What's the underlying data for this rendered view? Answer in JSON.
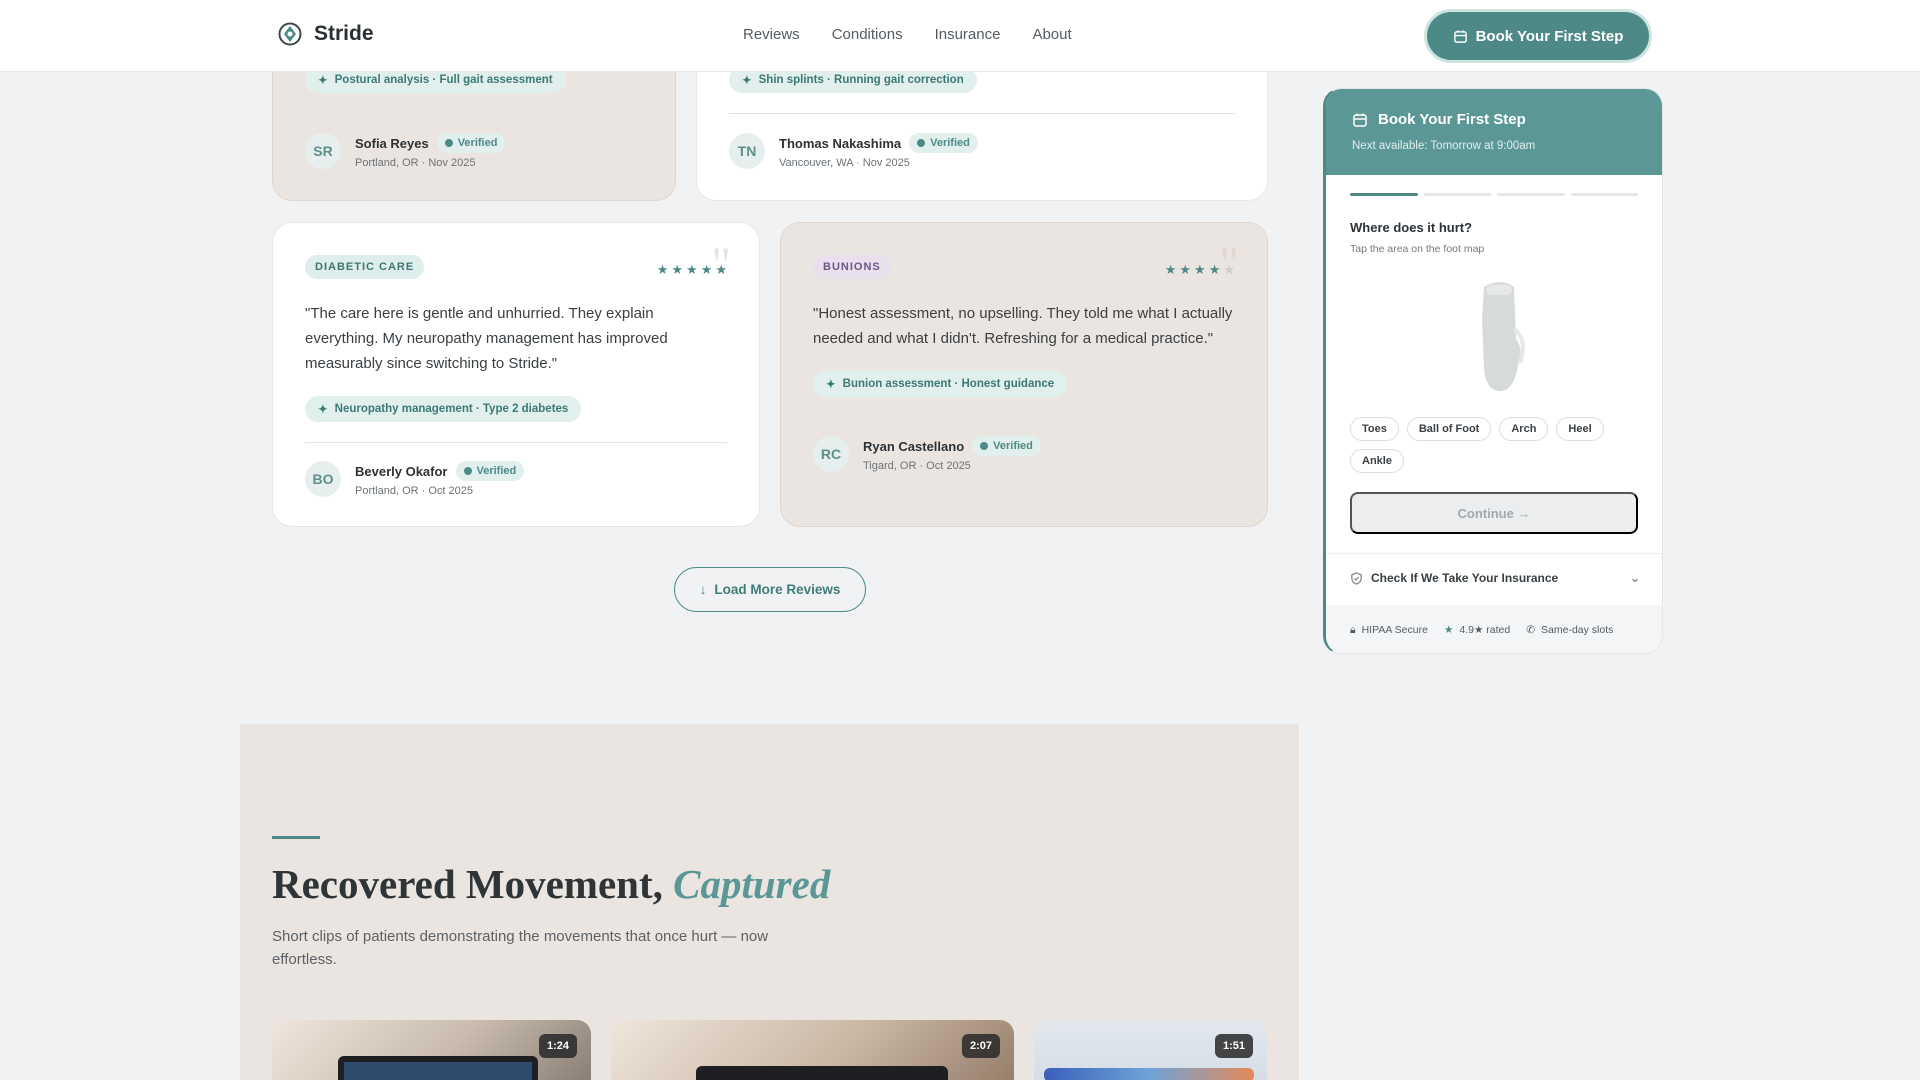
{
  "header": {
    "brand": "Stride",
    "nav": [
      "Reviews",
      "Conditions",
      "Insurance",
      "About"
    ],
    "cta": "Book Your First Step"
  },
  "reviews": [
    {
      "tag": "Postural analysis · Full gait assessment",
      "initials": "SR",
      "name": "Sofia Reyes",
      "verified": "Verified",
      "location": "Portland, OR · Nov 2025"
    },
    {
      "tag": "Shin splints · Running gait correction",
      "initials": "TN",
      "name": "Thomas Nakashima",
      "verified": "Verified",
      "location": "Vancouver, WA · Nov 2025"
    },
    {
      "category": "DIABETIC CARE",
      "rating": 5,
      "quote": "\"The care here is gentle and unhurried. They explain everything. My neuropathy management has improved measurably since switching to Stride.\"",
      "tag": "Neuropathy management · Type 2 diabetes",
      "initials": "BO",
      "name": "Beverly Okafor",
      "verified": "Verified",
      "location": "Portland, OR · Oct 2025"
    },
    {
      "category": "BUNIONS",
      "rating": 4,
      "quote": "\"Honest assessment, no upselling. They told me what I actually needed and what I didn't. Refreshing for a medical practice.\"",
      "tag": "Bunion assessment · Honest guidance",
      "initials": "RC",
      "name": "Ryan Castellano",
      "verified": "Verified",
      "location": "Tigard, OR · Oct 2025"
    }
  ],
  "load_more": "Load More Reviews",
  "widget": {
    "title": "Book Your First Step",
    "subtitle": "Next available: Tomorrow at 9:00am",
    "steps_total": 4,
    "step_current": 1,
    "question": "Where does it hurt?",
    "hint": "Tap the area on the foot map",
    "parts": [
      "Toes",
      "Ball of Foot",
      "Arch",
      "Heel",
      "Ankle"
    ],
    "continue": "Continue →",
    "insurance": "Check If We Take Your Insurance",
    "footer": [
      "HIPAA Secure",
      "4.9★ rated",
      "Same-day slots"
    ]
  },
  "movement": {
    "title_main": "Recovered Movement,",
    "title_em": "Captured",
    "description": "Short clips of patients demonstrating the movements that once hurt — now effortless.",
    "videos": [
      {
        "duration": "1:24"
      },
      {
        "duration": "2:07"
      },
      {
        "duration": "1:51"
      }
    ]
  },
  "colors": {
    "accent": "#4d8a87",
    "card_beige": "#ebe5e1",
    "page_bg": "#f1f2f3"
  }
}
